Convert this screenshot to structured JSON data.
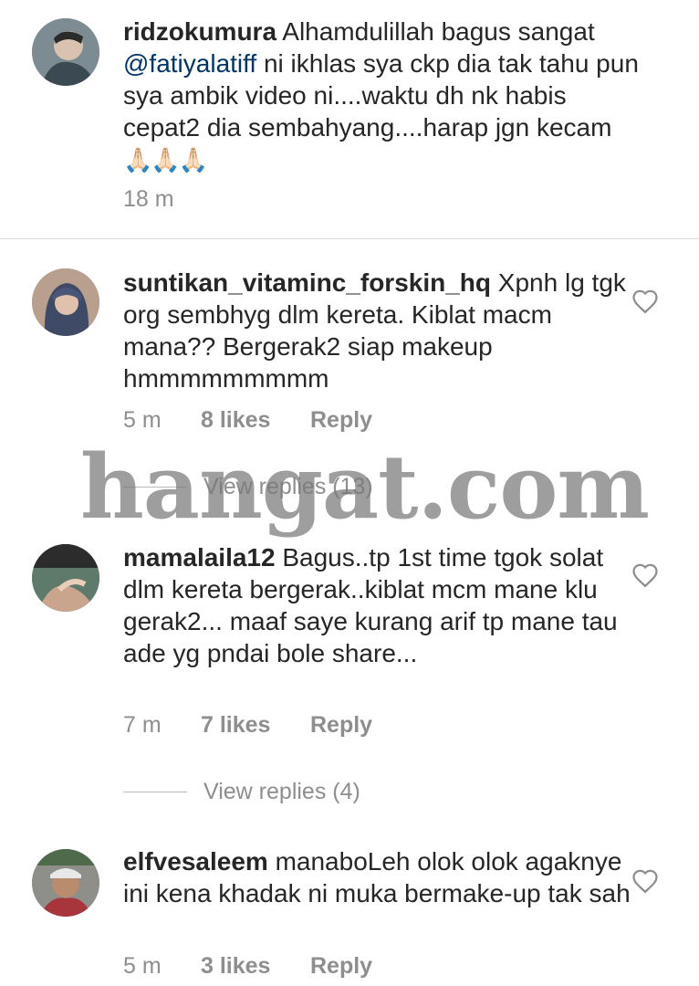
{
  "comments": [
    {
      "username": "ridzokumura",
      "text_before_mention": " Alhamdulillah bagus sangat ",
      "mention": "@fatiyalatiff",
      "text_after_mention": " ni ikhlas sya ckp dia tak tahu pun sya ambik video ni....waktu dh nk habis cepat2 dia sembahyang....harap jgn kecam",
      "emoji": "🙏🏻🙏🏻🙏🏻",
      "time": "18 m"
    },
    {
      "username": "suntikan_vitaminc_forskin_hq",
      "text": " Xpnh lg tgk org sembhyg dlm kereta. Kiblat macm mana?? Bergerak2 siap makeup hmmmmmmmmm",
      "time": "5 m",
      "likes": "8 likes",
      "reply": "Reply",
      "view_replies": "View replies (13)"
    },
    {
      "username": "mamalaila12",
      "text": " Bagus..tp 1st time tgok solat dlm kereta bergerak..kiblat mcm mane klu gerak2... maaf saye kurang arif tp mane tau ade yg pndai bole share...",
      "time": "7 m",
      "likes": "7 likes",
      "reply": "Reply",
      "view_replies": "View replies (4)"
    },
    {
      "username": "elfvesaleem",
      "text": " manaboLeh olok olok agaknye ini kena khadak ni muka bermake-up tak sah",
      "time": "5 m",
      "likes": "3 likes",
      "reply": "Reply"
    }
  ],
  "watermark": {
    "text": "hangat.com"
  },
  "colors": {
    "text": "#262626",
    "meta": "#8e8e8e",
    "mention": "#003569",
    "divider": "#dbdbdb"
  },
  "icons": {
    "like": "heart-outline-icon",
    "watermark_logo": "flame-icon"
  }
}
